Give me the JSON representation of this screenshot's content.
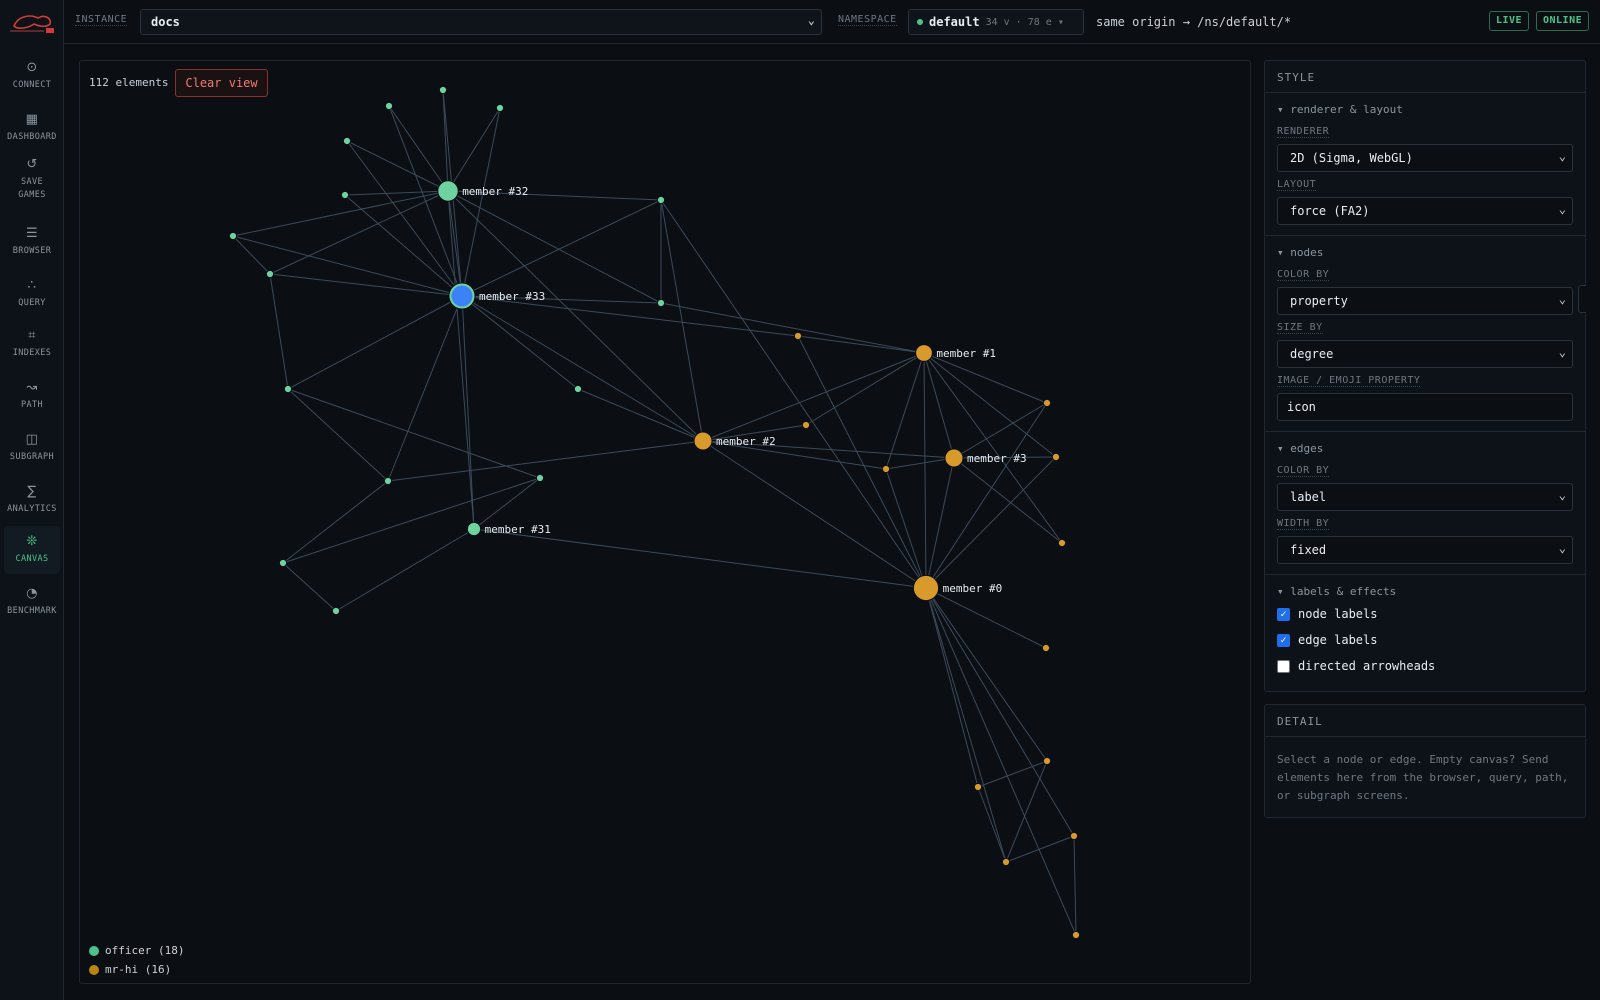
{
  "nav": {
    "items": [
      {
        "key": "connect",
        "label": "CONNECT",
        "icon": "⊙"
      },
      {
        "key": "dashboard",
        "label": "DASHBOARD",
        "icon": "▦"
      },
      {
        "key": "save-games",
        "label": "SAVE\nGAMES",
        "icon": "↺"
      },
      {
        "key": "browser",
        "label": "BROWSER",
        "icon": "☰"
      },
      {
        "key": "query",
        "label": "QUERY",
        "icon": "∴"
      },
      {
        "key": "indexes",
        "label": "INDEXES",
        "icon": "⌗"
      },
      {
        "key": "path",
        "label": "PATH",
        "icon": "↝"
      },
      {
        "key": "subgraph",
        "label": "SUBGRAPH",
        "icon": "◫"
      },
      {
        "key": "analytics",
        "label": "ANALYTICS",
        "icon": "∑"
      },
      {
        "key": "canvas",
        "label": "CANVAS",
        "icon": "❊",
        "active": true
      },
      {
        "key": "benchmark",
        "label": "BENCHMARK",
        "icon": "◔"
      }
    ]
  },
  "topbar": {
    "instance_label": "INSTANCE",
    "instance_value": "docs",
    "namespace_label": "NAMESPACE",
    "namespace_name": "default",
    "namespace_stats": "34 v · 78 e ▾",
    "origin": "same origin → /ns/default/*",
    "badge_live": "LIVE",
    "badge_online": "ONLINE"
  },
  "canvas": {
    "element_count": "112 elements",
    "clear_label": "Clear view",
    "legend": [
      {
        "label": "officer (18)",
        "color": "#4cc38a"
      },
      {
        "label": "mr-hi (16)",
        "color": "#b8860b"
      }
    ]
  },
  "graph": {
    "colors": {
      "officer": "#6fd3a0",
      "mr_hi": "#d89a2a",
      "edge": "#3c4a5a",
      "hub_blue": "#3b82f6"
    },
    "nodes": [
      {
        "id": 32,
        "group": "officer",
        "label": "member #32",
        "degree": 12
      },
      {
        "id": 33,
        "group": "officer",
        "label": "member #33",
        "degree": 17
      },
      {
        "id": 31,
        "group": "officer",
        "label": "member #31",
        "degree": 6
      },
      {
        "id": 2,
        "group": "mr-hi",
        "label": "member #2",
        "degree": 10
      },
      {
        "id": 1,
        "group": "mr-hi",
        "label": "member #1",
        "degree": 9
      },
      {
        "id": 3,
        "group": "mr-hi",
        "label": "member #3",
        "degree": 10
      },
      {
        "id": 0,
        "group": "mr-hi",
        "label": "member #0",
        "degree": 16
      },
      {
        "id": "o1",
        "group": "officer",
        "label": ""
      },
      {
        "id": "o2",
        "group": "officer",
        "label": ""
      },
      {
        "id": "o3",
        "group": "officer",
        "label": ""
      },
      {
        "id": "o4",
        "group": "officer",
        "label": ""
      },
      {
        "id": "o5",
        "group": "officer",
        "label": ""
      },
      {
        "id": "o6",
        "group": "officer",
        "label": ""
      },
      {
        "id": "o7",
        "group": "officer",
        "label": ""
      },
      {
        "id": "o8",
        "group": "officer",
        "label": ""
      },
      {
        "id": "o9",
        "group": "officer",
        "label": ""
      },
      {
        "id": "o10",
        "group": "officer",
        "label": ""
      },
      {
        "id": "o11",
        "group": "officer",
        "label": ""
      },
      {
        "id": "o12",
        "group": "officer",
        "label": ""
      },
      {
        "id": "o13",
        "group": "officer",
        "label": ""
      },
      {
        "id": "o14",
        "group": "officer",
        "label": ""
      },
      {
        "id": "o15",
        "group": "officer",
        "label": ""
      },
      {
        "id": "h1",
        "group": "mr-hi",
        "label": ""
      },
      {
        "id": "h2",
        "group": "mr-hi",
        "label": ""
      },
      {
        "id": "h3",
        "group": "mr-hi",
        "label": ""
      },
      {
        "id": "h4",
        "group": "mr-hi",
        "label": ""
      },
      {
        "id": "h5",
        "group": "mr-hi",
        "label": ""
      },
      {
        "id": "h6",
        "group": "mr-hi",
        "label": ""
      },
      {
        "id": "h7",
        "group": "mr-hi",
        "label": ""
      },
      {
        "id": "h8",
        "group": "mr-hi",
        "label": ""
      },
      {
        "id": "h9",
        "group": "mr-hi",
        "label": ""
      },
      {
        "id": "h10",
        "group": "mr-hi",
        "label": ""
      },
      {
        "id": "h11",
        "group": "mr-hi",
        "label": ""
      },
      {
        "id": "h12",
        "group": "mr-hi",
        "label": ""
      }
    ],
    "edges": [
      [
        32,
        "o1"
      ],
      [
        32,
        "o2"
      ],
      [
        32,
        "o3"
      ],
      [
        32,
        "o4"
      ],
      [
        32,
        "o5"
      ],
      [
        32,
        "o6"
      ],
      [
        32,
        "o8"
      ],
      [
        32,
        33
      ],
      [
        32,
        31
      ],
      [
        32,
        2
      ],
      [
        32,
        "o9"
      ],
      [
        32,
        "o7"
      ],
      [
        33,
        "o1"
      ],
      [
        33,
        "o2"
      ],
      [
        33,
        "o3"
      ],
      [
        33,
        "o4"
      ],
      [
        33,
        "o5"
      ],
      [
        33,
        "o6"
      ],
      [
        33,
        "o7"
      ],
      [
        33,
        "o8"
      ],
      [
        33,
        "o9"
      ],
      [
        33,
        "o10"
      ],
      [
        33,
        "o11"
      ],
      [
        33,
        31
      ],
      [
        33,
        "o12"
      ],
      [
        33,
        "h1"
      ],
      [
        33,
        2
      ],
      [
        "o7",
        "o6"
      ],
      [
        "o7",
        "o10"
      ],
      [
        "o10",
        "o12"
      ],
      [
        "o10",
        "o14"
      ],
      [
        "o12",
        2
      ],
      [
        "o12",
        "o13"
      ],
      [
        "o15",
        "o13"
      ],
      [
        "o15",
        31
      ],
      [
        "o14",
        31
      ],
      [
        "o14",
        "o13"
      ],
      [
        31,
        0
      ],
      [
        "o8",
        "o9"
      ],
      [
        "o8",
        0
      ],
      [
        "o8",
        2
      ],
      [
        "o9",
        1
      ],
      [
        "o11",
        2
      ],
      [
        "h1",
        1
      ],
      [
        1,
        2
      ],
      [
        1,
        0
      ],
      [
        1,
        3
      ],
      [
        1,
        "h2"
      ],
      [
        1,
        "h3"
      ],
      [
        1,
        "h4"
      ],
      [
        1,
        "h5"
      ],
      [
        1,
        "h6"
      ],
      [
        2,
        3
      ],
      [
        2,
        0
      ],
      [
        2,
        "h3"
      ],
      [
        2,
        "h4"
      ],
      [
        3,
        0
      ],
      [
        3,
        "h2"
      ],
      [
        3,
        "h4"
      ],
      [
        3,
        "h5"
      ],
      [
        3,
        "h6"
      ],
      [
        0,
        "h1"
      ],
      [
        0,
        "h2"
      ],
      [
        0,
        "h4"
      ],
      [
        0,
        "h5"
      ],
      [
        0,
        "h7"
      ],
      [
        0,
        "h8"
      ],
      [
        0,
        "h9"
      ],
      [
        0,
        "h10"
      ],
      [
        0,
        "h11"
      ],
      [
        0,
        "h12"
      ],
      [
        "h9",
        "h8"
      ],
      [
        "h8",
        "h10"
      ],
      [
        "h10",
        "h11"
      ],
      [
        "h11",
        "h12"
      ],
      [
        "h9",
        "h10"
      ]
    ]
  },
  "style": {
    "title": "STYLE",
    "renderer_section": "▾ renderer & layout",
    "renderer_label": "RENDERER",
    "renderer_value": "2D (Sigma, WebGL)",
    "layout_label": "LAYOUT",
    "layout_value": "force (FA2)",
    "nodes_section": "▾ nodes",
    "node_color_label": "COLOR BY",
    "node_color_value": "property",
    "size_label": "SIZE BY",
    "size_value": "degree",
    "image_label": "IMAGE / EMOJI PROPERTY",
    "image_value": "icon",
    "edges_section": "▾ edges",
    "edge_color_label": "COLOR BY",
    "edge_color_value": "label",
    "width_label": "WIDTH BY",
    "width_value": "fixed",
    "labels_section": "▾ labels & effects",
    "node_labels": {
      "label": "node labels",
      "checked": true
    },
    "edge_labels": {
      "label": "edge labels",
      "checked": true
    },
    "arrowheads": {
      "label": "directed arrowheads",
      "checked": false
    }
  },
  "detail": {
    "title": "DETAIL",
    "text": "Select a node or edge. Empty canvas? Send elements here from the browser, query, path, or subgraph screens."
  }
}
